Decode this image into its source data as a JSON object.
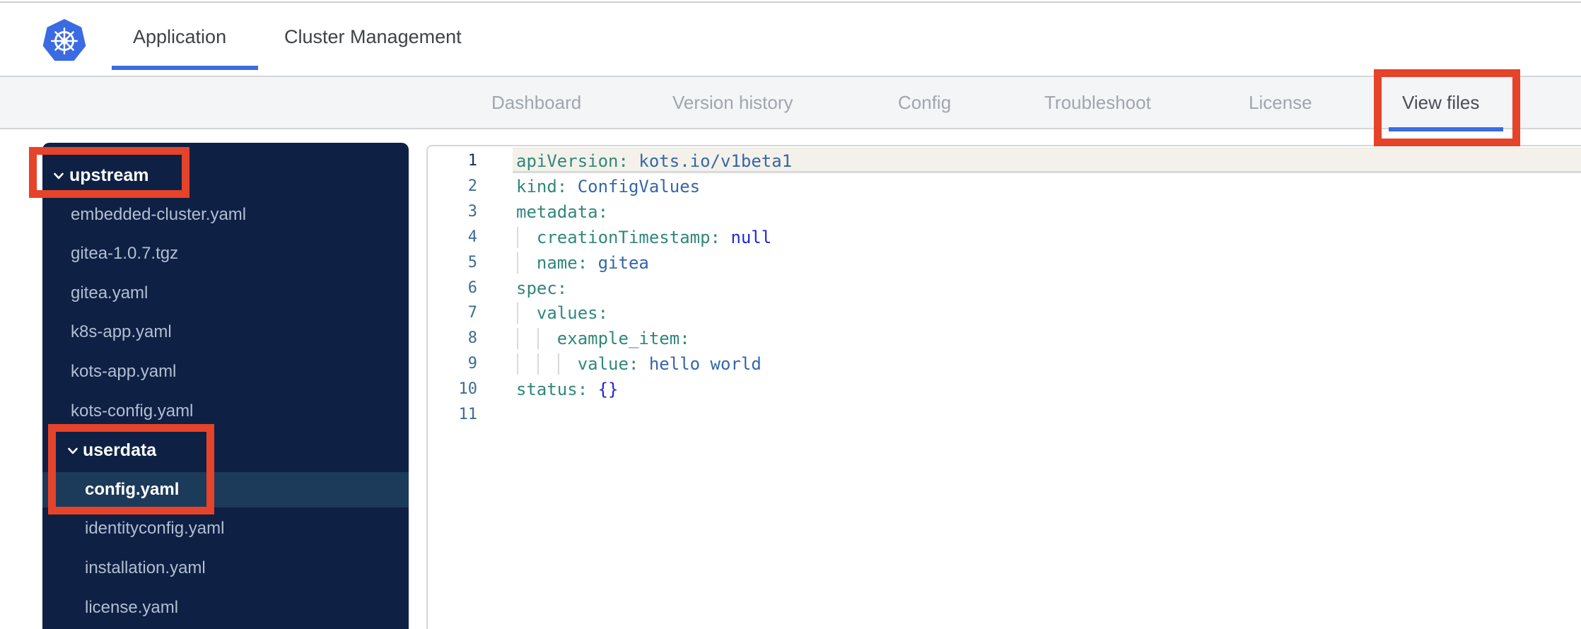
{
  "header": {
    "logo": "kubernetes-logo",
    "tabs": [
      {
        "label": "Application",
        "active": true
      },
      {
        "label": "Cluster Management",
        "active": false
      }
    ]
  },
  "subnav": {
    "items": [
      {
        "label": "Dashboard",
        "active": false
      },
      {
        "label": "Version history",
        "active": false
      },
      {
        "label": "Config",
        "active": false
      },
      {
        "label": "Troubleshoot",
        "active": false
      },
      {
        "label": "License",
        "active": false
      },
      {
        "label": "View files",
        "active": true
      }
    ]
  },
  "file_tree": {
    "rows": [
      {
        "type": "folder",
        "label": "upstream",
        "expanded": true,
        "level": 0
      },
      {
        "type": "file",
        "label": "embedded-cluster.yaml",
        "level": 1
      },
      {
        "type": "file",
        "label": "gitea-1.0.7.tgz",
        "level": 1
      },
      {
        "type": "file",
        "label": "gitea.yaml",
        "level": 1
      },
      {
        "type": "file",
        "label": "k8s-app.yaml",
        "level": 1
      },
      {
        "type": "file",
        "label": "kots-app.yaml",
        "level": 1
      },
      {
        "type": "file",
        "label": "kots-config.yaml",
        "level": 1
      },
      {
        "type": "folder",
        "label": "userdata",
        "expanded": true,
        "level": 1
      },
      {
        "type": "file",
        "label": "config.yaml",
        "level": 2,
        "selected": true
      },
      {
        "type": "file",
        "label": "identityconfig.yaml",
        "level": 2
      },
      {
        "type": "file",
        "label": "installation.yaml",
        "level": 2
      },
      {
        "type": "file",
        "label": "license.yaml",
        "level": 2
      }
    ]
  },
  "editor": {
    "language": "yaml",
    "active_line": 1,
    "lines": [
      {
        "num": 1,
        "guides": 0,
        "tokens": [
          {
            "c": "key",
            "t": "apiVersion:"
          },
          {
            "c": "plain",
            "t": " "
          },
          {
            "c": "val",
            "t": "kots.io/v1beta1"
          }
        ]
      },
      {
        "num": 2,
        "guides": 0,
        "tokens": [
          {
            "c": "key",
            "t": "kind:"
          },
          {
            "c": "plain",
            "t": " "
          },
          {
            "c": "val",
            "t": "ConfigValues"
          }
        ]
      },
      {
        "num": 3,
        "guides": 0,
        "tokens": [
          {
            "c": "key",
            "t": "metadata:"
          }
        ]
      },
      {
        "num": 4,
        "guides": 1,
        "tokens": [
          {
            "c": "plain",
            "t": "  "
          },
          {
            "c": "key",
            "t": "creationTimestamp:"
          },
          {
            "c": "plain",
            "t": " "
          },
          {
            "c": "kw",
            "t": "null"
          }
        ]
      },
      {
        "num": 5,
        "guides": 1,
        "tokens": [
          {
            "c": "plain",
            "t": "  "
          },
          {
            "c": "key",
            "t": "name:"
          },
          {
            "c": "plain",
            "t": " "
          },
          {
            "c": "val",
            "t": "gitea"
          }
        ]
      },
      {
        "num": 6,
        "guides": 0,
        "tokens": [
          {
            "c": "key",
            "t": "spec:"
          }
        ]
      },
      {
        "num": 7,
        "guides": 1,
        "tokens": [
          {
            "c": "plain",
            "t": "  "
          },
          {
            "c": "key",
            "t": "values:"
          }
        ]
      },
      {
        "num": 8,
        "guides": 2,
        "tokens": [
          {
            "c": "plain",
            "t": "    "
          },
          {
            "c": "key",
            "t": "example_item:"
          }
        ]
      },
      {
        "num": 9,
        "guides": 3,
        "tokens": [
          {
            "c": "plain",
            "t": "      "
          },
          {
            "c": "key",
            "t": "value:"
          },
          {
            "c": "plain",
            "t": " "
          },
          {
            "c": "val",
            "t": "hello world"
          }
        ]
      },
      {
        "num": 10,
        "guides": 0,
        "tokens": [
          {
            "c": "key",
            "t": "status:"
          },
          {
            "c": "plain",
            "t": " "
          },
          {
            "c": "kw",
            "t": "{}"
          }
        ]
      },
      {
        "num": 11,
        "guides": 0,
        "tokens": []
      }
    ]
  },
  "annotations": {
    "note": "red highlight boxes drawn over UI",
    "boxes": [
      "view-files-tab",
      "upstream-folder",
      "userdata-config-yaml"
    ],
    "color": "#e5432a"
  },
  "colors": {
    "brand_blue": "#3c6ce0",
    "logo_blue": "#3a6be2",
    "sidebar_bg": "#0e2144",
    "sidebar_selected_bg": "#1c3a5a",
    "sidebar_file_text": "#b2bed2",
    "subnav_bg": "#f4f5f7",
    "code_key": "#31877c",
    "code_value": "#3566a8",
    "code_keyword": "#2127d6",
    "gutter_number": "#3d6b92",
    "annotation_red": "#e5432a"
  }
}
